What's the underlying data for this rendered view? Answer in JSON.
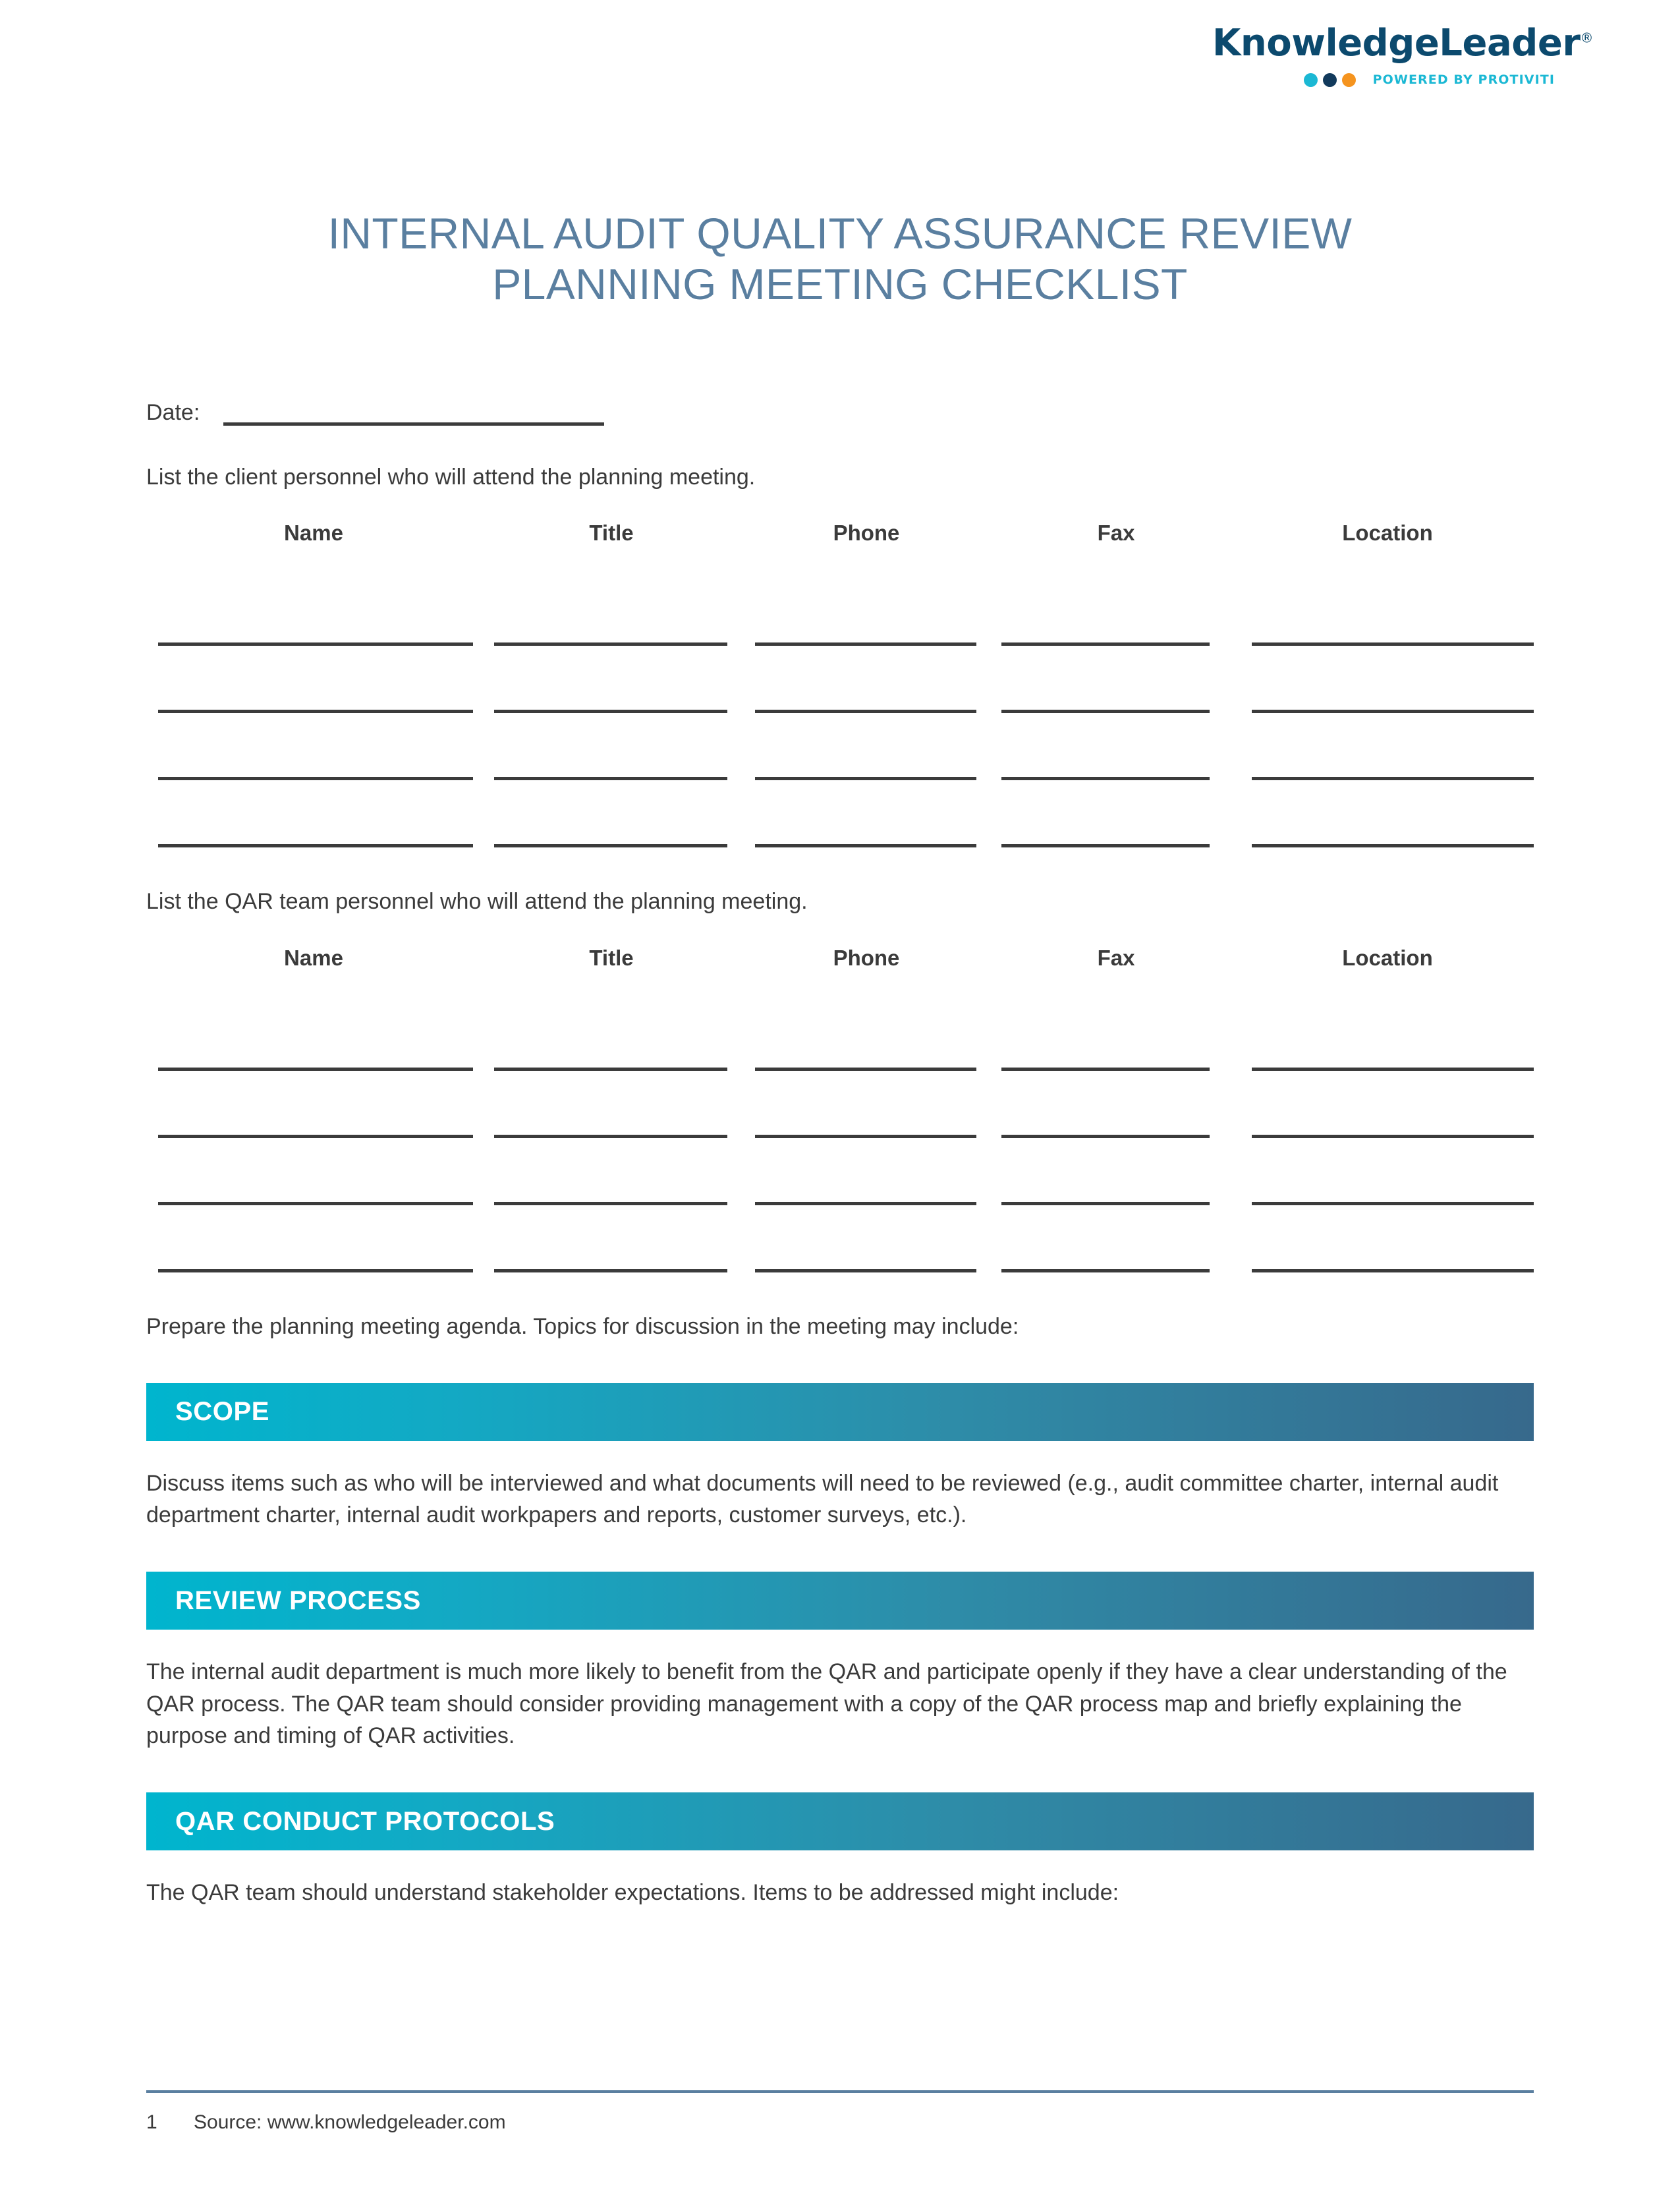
{
  "brand": {
    "wordmark": "KnowledgeLeader",
    "registered_mark": "®",
    "tagline": "POWERED BY PROTIVITI",
    "dot_colors": [
      "#1BB8D4",
      "#123A5C",
      "#F5941F"
    ],
    "wordmark_color": "#0C4A6E",
    "tagline_color": "#1BB8D4"
  },
  "document": {
    "title_line_1": "INTERNAL AUDIT QUALITY ASSURANCE REVIEW",
    "title_line_2": "PLANNING MEETING CHECKLIST",
    "title_color": "#5A7FA0"
  },
  "form": {
    "date_label": "Date:",
    "date_value": ""
  },
  "client_table": {
    "lead_in": "List the client personnel who will attend the planning meeting.",
    "columns": [
      "Name",
      "Title",
      "Phone",
      "Fax",
      "Location"
    ],
    "rows": [
      [
        "",
        "",
        "",
        "",
        ""
      ],
      [
        "",
        "",
        "",
        "",
        ""
      ],
      [
        "",
        "",
        "",
        "",
        ""
      ],
      [
        "",
        "",
        "",
        "",
        ""
      ]
    ]
  },
  "qar_table": {
    "lead_in": "List the QAR team personnel who will attend the planning meeting.",
    "columns": [
      "Name",
      "Title",
      "Phone",
      "Fax",
      "Location"
    ],
    "rows": [
      [
        "",
        "",
        "",
        "",
        ""
      ],
      [
        "",
        "",
        "",
        "",
        ""
      ],
      [
        "",
        "",
        "",
        "",
        ""
      ],
      [
        "",
        "",
        "",
        "",
        ""
      ]
    ]
  },
  "agenda_intro": "Prepare the planning meeting agenda. Topics for discussion in the meeting may include:",
  "sections": [
    {
      "heading": "SCOPE",
      "body": "Discuss items such as who will be interviewed and what documents will need to be reviewed (e.g., audit committee charter, internal audit department charter, internal audit workpapers and reports, customer surveys, etc.)."
    },
    {
      "heading": "REVIEW PROCESS",
      "body": "The internal audit department is much more likely to benefit from the QAR and participate openly if they have a clear understanding of the QAR process. The QAR team should consider providing management with a copy of the QAR process map and briefly explaining the purpose and timing of QAR activities."
    },
    {
      "heading": "QAR CONDUCT PROTOCOLS",
      "body": "The QAR team should understand stakeholder expectations. Items to be addressed might include:"
    }
  ],
  "banner_colors": {
    "gradient_start": "#00B5CE",
    "gradient_end": "#37698C",
    "text": "#FFFFFF"
  },
  "footer": {
    "page_number": "1",
    "source": "Source: www.knowledgeleader.com",
    "rule_color": "#5A7FA0"
  }
}
